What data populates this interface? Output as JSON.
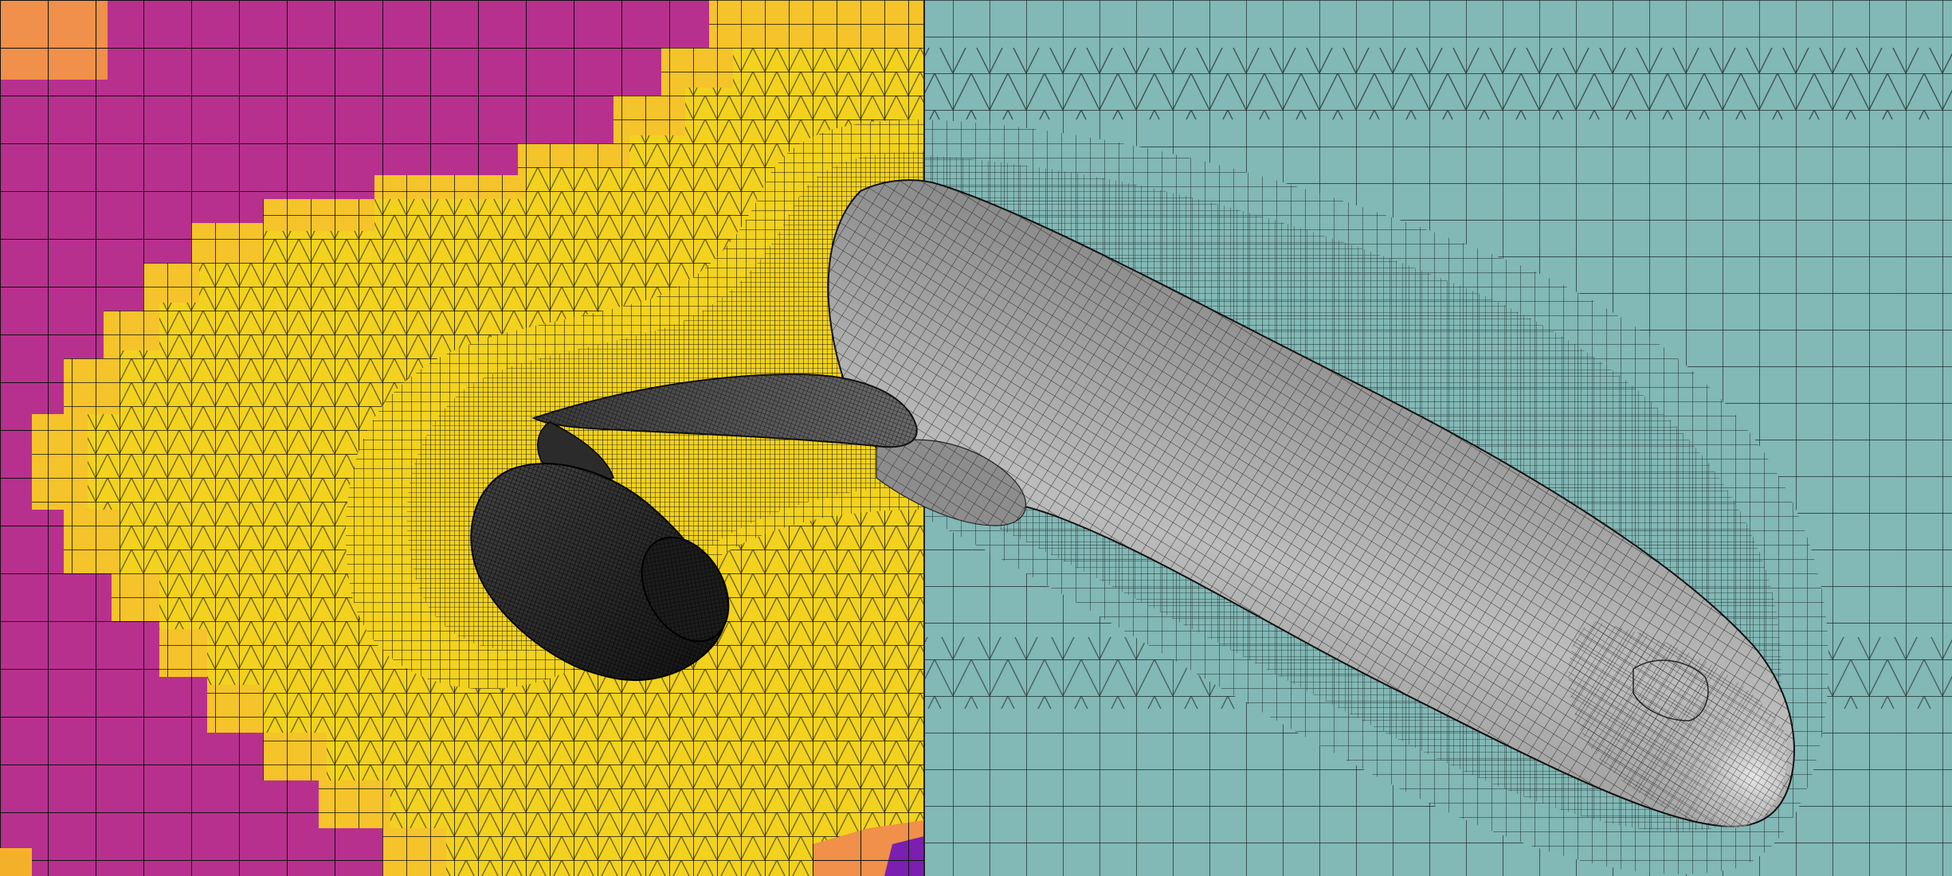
{
  "scene": {
    "subject": "mesh-visualization",
    "regions": [
      {
        "name": "left-far-field",
        "color": "#b8308e"
      },
      {
        "name": "left-refinement-zone",
        "color": "#f2d21e"
      },
      {
        "name": "left-refinement-zone-secondary",
        "color": "#f5c32a"
      },
      {
        "name": "corner-cells-warm",
        "color": "#f0904a"
      },
      {
        "name": "right-symmetry-plane",
        "color": "#82b8b6"
      },
      {
        "name": "surface-mesh",
        "color": "#8c8c8c"
      },
      {
        "name": "mesh-lines",
        "color": "#000000"
      }
    ]
  }
}
